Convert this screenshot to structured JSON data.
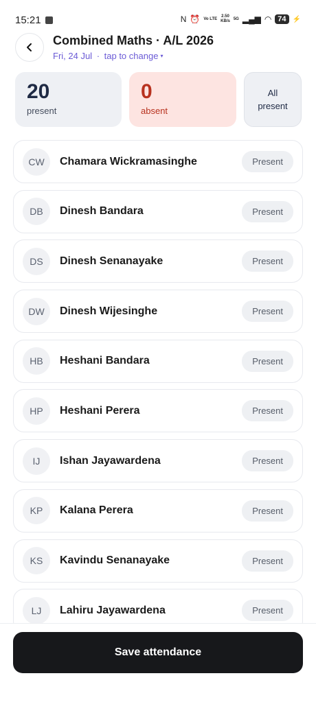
{
  "status_bar": {
    "time": "15:21",
    "volte_label": "Vo LTE",
    "speed_value": "2.50",
    "speed_unit": "KB/s",
    "network": "5G",
    "battery": "74"
  },
  "header": {
    "title": "Combined Maths · A/L 2026",
    "date": "Fri, 24 Jul",
    "date_separator": " · ",
    "change_hint": "tap to change",
    "caret": "▾"
  },
  "stats": {
    "present_count": "20",
    "present_label": "present",
    "absent_count": "0",
    "absent_label": "absent",
    "all_present_line1": "All",
    "all_present_line2": "present"
  },
  "students": [
    {
      "initials": "CW",
      "name": "Chamara Wickramasinghe",
      "status": "Present"
    },
    {
      "initials": "DB",
      "name": "Dinesh Bandara",
      "status": "Present"
    },
    {
      "initials": "DS",
      "name": "Dinesh Senanayake",
      "status": "Present"
    },
    {
      "initials": "DW",
      "name": "Dinesh Wijesinghe",
      "status": "Present"
    },
    {
      "initials": "HB",
      "name": "Heshani Bandara",
      "status": "Present"
    },
    {
      "initials": "HP",
      "name": "Heshani Perera",
      "status": "Present"
    },
    {
      "initials": "IJ",
      "name": "Ishan Jayawardena",
      "status": "Present"
    },
    {
      "initials": "KP",
      "name": "Kalana Perera",
      "status": "Present"
    },
    {
      "initials": "KS",
      "name": "Kavindu Senanayake",
      "status": "Present"
    },
    {
      "initials": "LJ",
      "name": "Lahiru Jayawardena",
      "status": "Present"
    }
  ],
  "footer": {
    "save_label": "Save attendance"
  },
  "colors": {
    "accent": "#6b5bd6",
    "absent": "#b8321f",
    "absent_bg": "#fde4e1",
    "button_bg": "#17181b"
  }
}
